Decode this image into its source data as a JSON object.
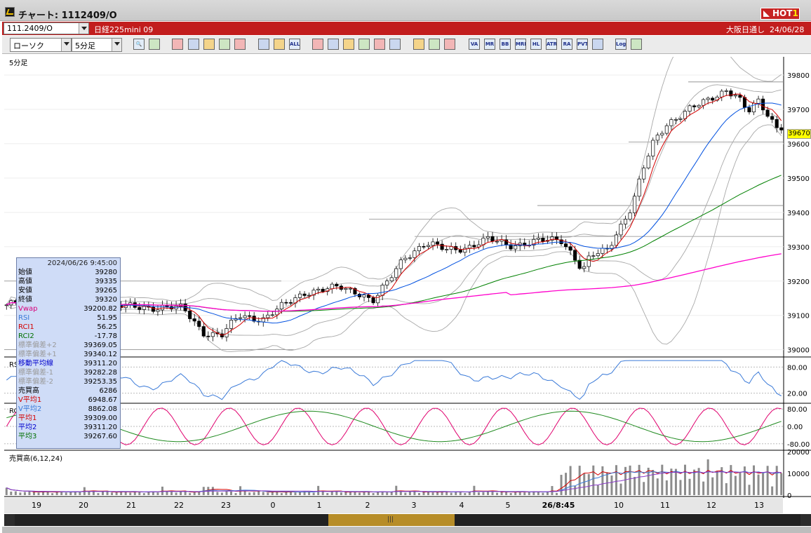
{
  "window": {
    "title": "チャート: 1112409/O",
    "hot_label": "HOT",
    "hot_number": "1"
  },
  "symbol_bar": {
    "code": "111.2409/O",
    "name": "日経225mini 09",
    "session": "大阪日通し",
    "date": "24/06/28"
  },
  "toolbar": {
    "chart_type": "ローソク",
    "interval": "5分足",
    "buttons": [
      "zoom",
      "layout",
      "trend1",
      "search",
      "compare",
      "reverse",
      "lock",
      "candle1",
      "candle2",
      "all",
      "pen",
      "cursor",
      "arrow",
      "redo",
      "doc",
      "trash",
      "grid",
      "paint",
      "color",
      "va",
      "mr",
      "bb",
      "mre",
      "hl",
      "atr",
      "ra",
      "pvt",
      "box",
      "log",
      "exit"
    ]
  },
  "chart": {
    "interval_label": "5分足",
    "last_price": "39670",
    "price_axis": [
      "39800",
      "39700",
      "39600",
      "39500",
      "39400",
      "39300",
      "39200",
      "39100",
      "39000"
    ],
    "rsi_axis": [
      "80.00",
      "20.00"
    ],
    "rci_axis": [
      "80.00",
      "0.00",
      "-80.00"
    ],
    "volume_axis": [
      "20000",
      "10000",
      "0"
    ],
    "rsi_label": "RSI",
    "rci_label": "RCI",
    "volume_label": "売買高(6,12,24)",
    "time_labels": [
      "19",
      "20",
      "21",
      "22",
      "23",
      "0",
      "1",
      "2",
      "3",
      "4",
      "5",
      "26/8:45",
      "10",
      "11",
      "12",
      "13"
    ]
  },
  "ohlc_panel": {
    "timestamp": "2024/06/26  9:45:00",
    "rows": [
      {
        "label": "始値",
        "value": "39280",
        "color": "#000000"
      },
      {
        "label": "高値",
        "value": "39335",
        "color": "#000000"
      },
      {
        "label": "安値",
        "value": "39265",
        "color": "#000000"
      },
      {
        "label": "終値",
        "value": "39320",
        "color": "#000000"
      },
      {
        "label": "Vwap",
        "value": "39200.82",
        "color": "#d8007a"
      },
      {
        "label": "RSI",
        "value": "51.95",
        "color": "#3a7ad8"
      },
      {
        "label": "RCI1",
        "value": "56.25",
        "color": "#d40000"
      },
      {
        "label": "RCI2",
        "value": "-17.78",
        "color": "#007000"
      },
      {
        "label": "標準偏差+2",
        "value": "39369.05",
        "color": "#9a9a9a"
      },
      {
        "label": "標準偏差+1",
        "value": "39340.12",
        "color": "#9a9a9a"
      },
      {
        "label": "移動平均線",
        "value": "39311.20",
        "color": "#0000cc"
      },
      {
        "label": "標準偏差-1",
        "value": "39282.28",
        "color": "#9a9a9a"
      },
      {
        "label": "標準偏差-2",
        "value": "39253.35",
        "color": "#9a9a9a"
      },
      {
        "label": "売買高",
        "value": "6286",
        "color": "#000000"
      },
      {
        "label": "V平均1",
        "value": "6948.67",
        "color": "#d40000"
      },
      {
        "label": "V平均2",
        "value": "8862.08",
        "color": "#3a7ad8"
      },
      {
        "label": "平均1",
        "value": "39309.00",
        "color": "#d40000"
      },
      {
        "label": "平均2",
        "value": "39311.20",
        "color": "#0000cc"
      },
      {
        "label": "平均3",
        "value": "39267.60",
        "color": "#007000"
      }
    ]
  },
  "colors": {
    "title_red": "#c21d1d",
    "ma_short": "#d40000",
    "ma_mid": "#0050e0",
    "ma_long": "#008000",
    "vwap": "#ff00cc",
    "band": "#a8a8a8",
    "rsi": "#3a7ad8",
    "rci1": "#e0006e",
    "rci2": "#1f8a1f"
  }
}
